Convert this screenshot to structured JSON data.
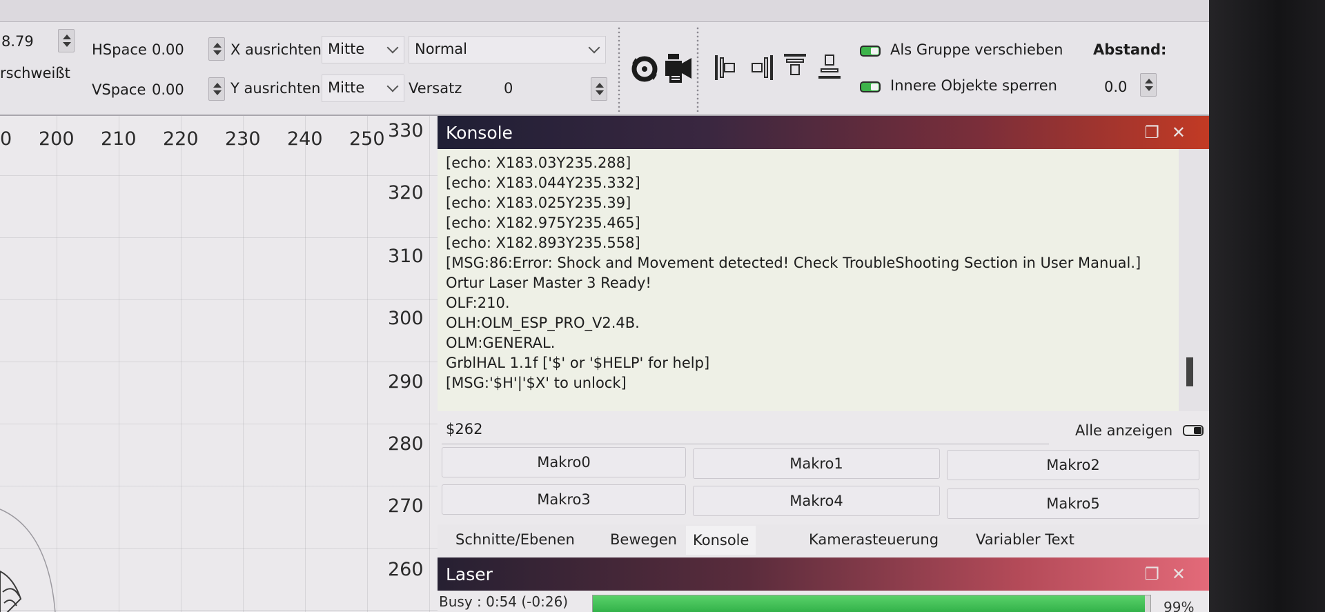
{
  "toolbar": {
    "width_value": "8.79",
    "weld_label": "rschweißt",
    "hspace_label": "HSpace",
    "hspace_value": "0.00",
    "vspace_label": "VSpace",
    "vspace_value": "0.00",
    "x_align_label": "X ausrichten",
    "x_align_value": "Mitte",
    "y_align_label": "Y ausrichten",
    "y_align_value": "Mitte",
    "mode_value": "Normal",
    "offset_label": "Versatz",
    "offset_value": "0",
    "move_group_label": "Als Gruppe verschieben",
    "lock_inner_label": "Innere Objekte sperren",
    "spacing_label": "Abstand:",
    "spacing_value": "0.0"
  },
  "ruler": {
    "x_ticks": [
      "0",
      "200",
      "210",
      "220",
      "230",
      "240",
      "250"
    ],
    "y_ticks": [
      "330",
      "320",
      "310",
      "300",
      "290",
      "280",
      "270",
      "260"
    ]
  },
  "konsole": {
    "title": "Konsole",
    "log_lines": [
      "[echo: X183.03Y235.288]",
      "[echo: X183.044Y235.332]",
      "[echo: X183.025Y235.39]",
      "[echo: X182.975Y235.465]",
      "[echo: X182.893Y235.558]",
      "[MSG:86:Error: Shock and Movement detected! Check TroubleShooting Section in User Manual.]",
      "Ortur Laser Master 3 Ready!",
      "OLF:210.",
      "OLH:OLM_ESP_PRO_V2.4B.",
      "OLM:GENERAL.",
      "GrblHAL 1.1f ['$' or '$HELP' for help]",
      "[MSG:'$H'|'$X' to unlock]"
    ],
    "command_value": "$262",
    "show_all_label": "Alle anzeigen",
    "macros": [
      "Makro0",
      "Makro1",
      "Makro2",
      "Makro3",
      "Makro4",
      "Makro5"
    ],
    "tabs": [
      "Schnitte/Ebenen",
      "Bewegen",
      "Konsole",
      "Kamerasteuerung",
      "Variabler Text"
    ],
    "active_tab": "Konsole"
  },
  "laser": {
    "title": "Laser",
    "busy_text": "Busy : 0:54 (-0:26)",
    "progress_percent": 99,
    "progress_text": "99%"
  },
  "colors": {
    "console_title_gradient": [
      "#1f1f35",
      "#c23a24"
    ],
    "laser_title_gradient": [
      "#262032",
      "#e36a79"
    ],
    "progress_green": "#33b24a",
    "toggle_on": "#3db34a"
  },
  "icons": [
    "spinner-icon",
    "camera-icon",
    "align-left-icon",
    "align-center-icon",
    "align-top-icon",
    "align-bottom-icon",
    "window-restore-icon",
    "close-icon"
  ]
}
